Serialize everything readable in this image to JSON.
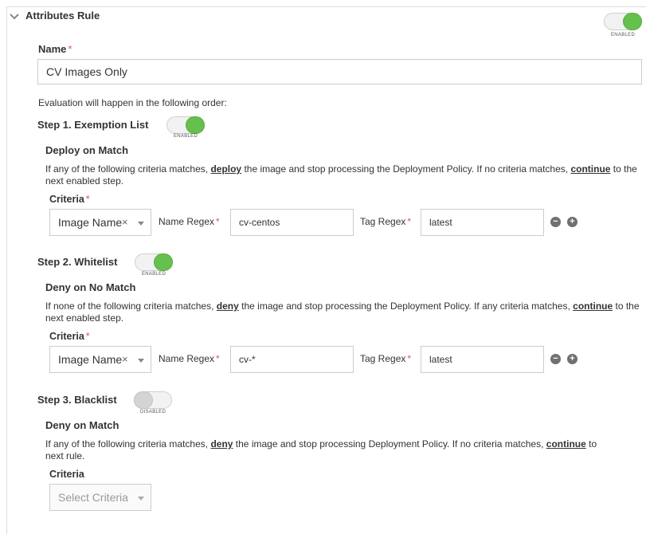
{
  "rule": {
    "title": "Attributes Rule",
    "toggle_caption": "ENABLED",
    "name_label": "Name",
    "required_mark": "*",
    "name_value": "CV Images Only",
    "evaluation_note": "Evaluation will happen in the following order:"
  },
  "steps": [
    {
      "title": "Step 1. Exemption List",
      "toggle_state": "on",
      "toggle_caption": "ENABLED",
      "action_title": "Deploy on Match",
      "desc_pre": "If any of the following criteria matches,",
      "desc_keyword": "deploy",
      "desc_mid": "the image and stop processing the Deployment Policy. If no criteria matches,",
      "desc_keyword2": "continue",
      "desc_post": "to the next enabled step.",
      "criteria_label": "Criteria",
      "criteria_select": "Image Name",
      "name_regex_label": "Name Regex",
      "name_regex_value": "cv-centos",
      "tag_regex_label": "Tag Regex",
      "tag_regex_value": "latest"
    },
    {
      "title": "Step 2. Whitelist",
      "toggle_state": "on",
      "toggle_caption": "ENABLED",
      "action_title": "Deny on No Match",
      "desc_pre": "If none of the following criteria matches,",
      "desc_keyword": "deny",
      "desc_mid": "the image and stop processing the Deployment Policy. If any criteria matches,",
      "desc_keyword2": "continue",
      "desc_post": "to the next enabled step.",
      "criteria_label": "Criteria",
      "criteria_select": "Image Name",
      "name_regex_label": "Name Regex",
      "name_regex_value": "cv-*",
      "tag_regex_label": "Tag Regex",
      "tag_regex_value": "latest"
    },
    {
      "title": "Step 3. Blacklist",
      "toggle_state": "off",
      "toggle_caption": "DISABLED",
      "action_title": "Deny on Match",
      "desc_pre": "If any of the following criteria matches,",
      "desc_keyword": "deny",
      "desc_mid": "the image and stop processing Deployment Policy. If no criteria matches,",
      "desc_keyword2": "continue",
      "desc_post": "to",
      "desc_line2": "next rule.",
      "criteria_label": "Criteria",
      "criteria_placeholder": "Select Criteria"
    }
  ],
  "icons": {
    "collapse": "chevron-down-icon",
    "clear": "×",
    "remove": "minus-circle-icon",
    "add": "plus-circle-icon"
  },
  "colors": {
    "toggle_on": "#66c04d",
    "toggle_off": "#d4d4d4",
    "required": "#e05555"
  }
}
